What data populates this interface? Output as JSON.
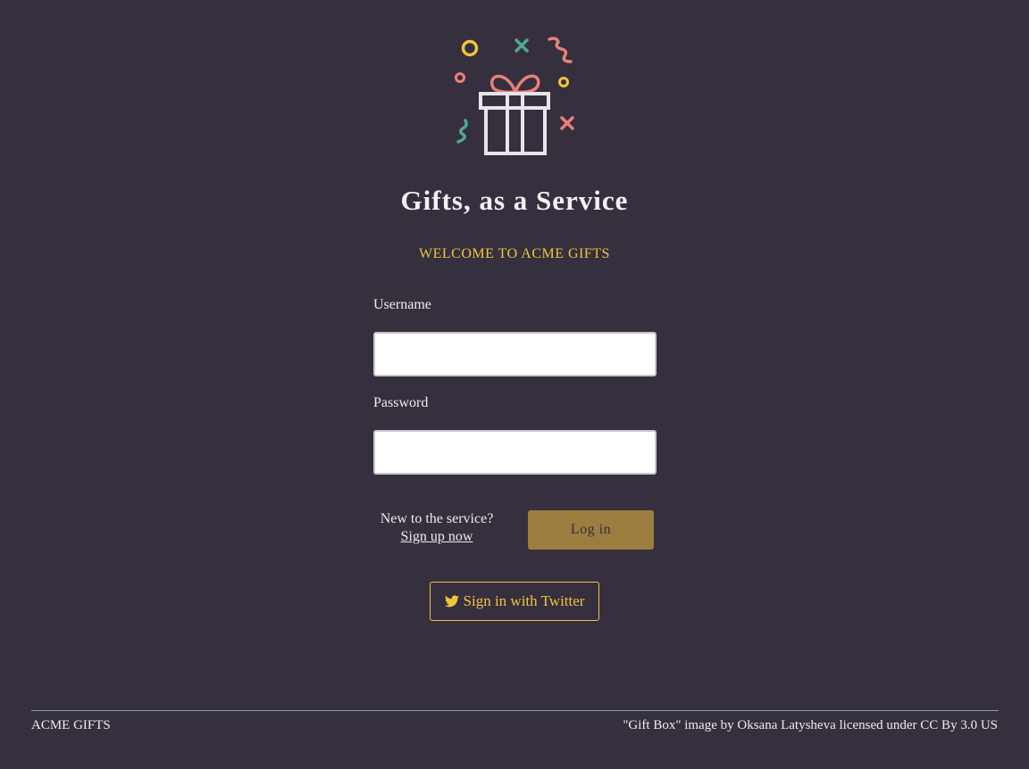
{
  "app": {
    "title": "Gifts, as a Service",
    "welcome": "WELCOME TO ACME GIFTS",
    "logo_icon": "gift-box-confetti-icon"
  },
  "form": {
    "username_label": "Username",
    "username_value": "",
    "password_label": "Password",
    "password_value": "",
    "new_to_service": "New to the service?",
    "signup_link": "Sign up now",
    "login_button": "Log in",
    "twitter_button": "Sign in with Twitter",
    "twitter_icon": "twitter-bird-icon"
  },
  "footer": {
    "brand": "ACME GIFTS",
    "credit": "\"Gift Box\" image by Oksana Latysheva licensed under CC By 3.0 US"
  },
  "colors": {
    "background": "#352f3e",
    "accent_yellow": "#f0c43f",
    "button_gold": "#9a7d3f",
    "confetti_pink": "#e98079",
    "confetti_green": "#4fa890",
    "footer_rule": "#7fa9a8"
  }
}
